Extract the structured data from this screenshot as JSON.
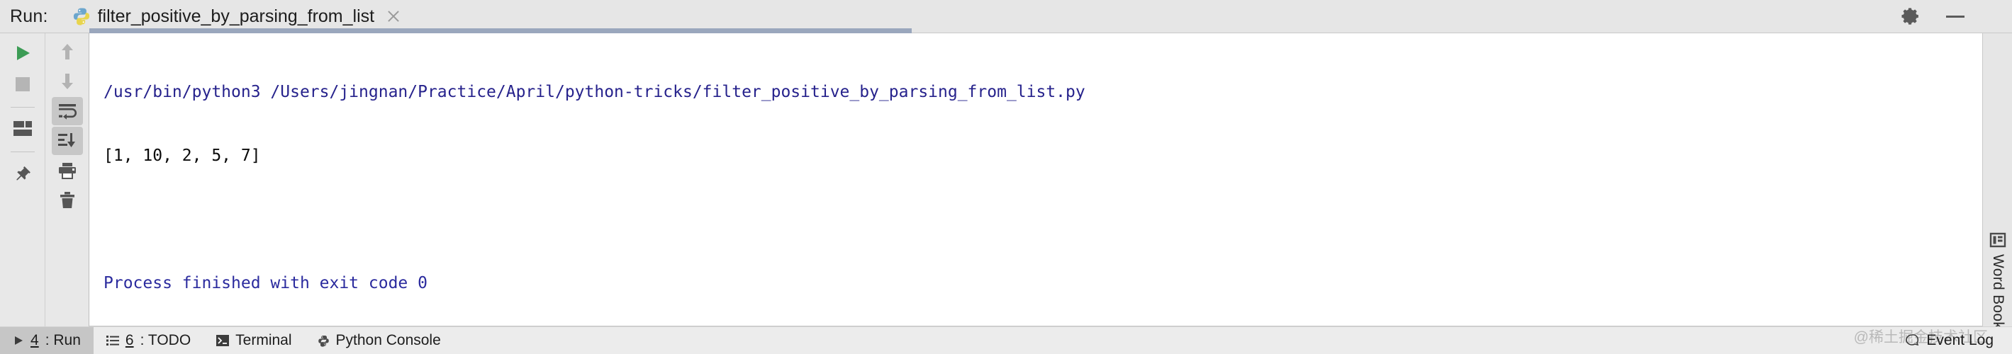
{
  "header": {
    "run_label": "Run:",
    "tab_title": "filter_positive_by_parsing_from_list",
    "tab_icon": "python-icon",
    "close_icon": "close-icon",
    "settings_icon": "gear-icon",
    "minimize_icon": "minimize-icon"
  },
  "toolbar_left": {
    "items": [
      {
        "name": "rerun-button",
        "icon": "play-icon"
      },
      {
        "name": "stop-button",
        "icon": "stop-square-icon"
      },
      {
        "name": "restore-layout-button",
        "icon": "layout-icon"
      },
      {
        "name": "pin-tab-button",
        "icon": "pin-icon"
      }
    ]
  },
  "toolbar_right": {
    "items": [
      {
        "name": "up-the-stack-trace-button",
        "icon": "arrow-up-icon",
        "active": false
      },
      {
        "name": "down-the-stack-trace-button",
        "icon": "arrow-down-icon",
        "active": false
      },
      {
        "name": "soft-wrap-button",
        "icon": "soft-wrap-icon",
        "active": true
      },
      {
        "name": "scroll-to-end-button",
        "icon": "scroll-to-end-icon",
        "active": true
      },
      {
        "name": "print-button",
        "icon": "printer-icon",
        "active": false
      },
      {
        "name": "clear-all-button",
        "icon": "trash-icon",
        "active": false
      }
    ]
  },
  "console": {
    "lines": [
      {
        "text": "/usr/bin/python3 /Users/jingnan/Practice/April/python-tricks/filter_positive_by_parsing_from_list.py",
        "style": "link"
      },
      {
        "text": "[1, 10, 2, 5, 7]",
        "style": "plain"
      },
      {
        "text": "",
        "style": "blank"
      },
      {
        "text": "Process finished with exit code 0",
        "style": "info"
      }
    ],
    "colors": {
      "link": "#26228c",
      "plain": "#0a0a0a",
      "info": "#2b2b9e",
      "background": "#ffffff"
    }
  },
  "right_sidebar": {
    "word_book_label": "Word Book",
    "word_book_icon": "book-panel-icon"
  },
  "statusbar": {
    "items": [
      {
        "name": "status-run",
        "icon": "play-icon",
        "shortcut": "4",
        "label": ": Run",
        "active": true
      },
      {
        "name": "status-todo",
        "icon": "list-icon",
        "shortcut": "6",
        "label": ": TODO",
        "active": false
      },
      {
        "name": "status-terminal",
        "icon": "terminal-icon",
        "shortcut": "",
        "label": "Terminal",
        "active": false
      },
      {
        "name": "status-python-console",
        "icon": "python-icon",
        "shortcut": "",
        "label": "Python Console",
        "active": false
      }
    ],
    "event_log": "Event Log",
    "event_log_icon": "balloon-icon",
    "watermark": "@稀土掘金技术社区"
  }
}
